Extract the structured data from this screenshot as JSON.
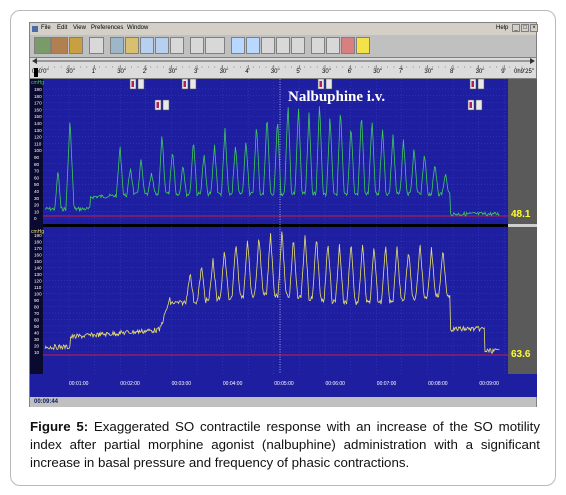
{
  "menu": [
    "File",
    "Edit",
    "View",
    "Preferences",
    "Window"
  ],
  "help_label": "Help",
  "window_controls": [
    "_",
    "□",
    "×"
  ],
  "ruler": {
    "start_label": "0h0'0\"",
    "end_label": "0h9'25\"",
    "labels": [
      "30\"",
      "1'",
      "30\"",
      "2'",
      "30\"",
      "3'",
      "30\"",
      "4'",
      "30\"",
      "5'",
      "30\"",
      "6'",
      "30\"",
      "7'",
      "30\"",
      "8'",
      "30\"",
      "9'"
    ]
  },
  "annotation_text": "Nalbuphine i.v.",
  "top_channel": {
    "unit": "cmHg",
    "ticks": [
      "190",
      "180",
      "170",
      "160",
      "150",
      "140",
      "130",
      "120",
      "110",
      "100",
      "90",
      "80",
      "70",
      "60",
      "50",
      "40",
      "30",
      "20",
      "10",
      "0"
    ],
    "value_readout": "48.1"
  },
  "bottom_channel": {
    "unit": "cmHg",
    "ticks": [
      "190",
      "180",
      "170",
      "160",
      "150",
      "140",
      "130",
      "120",
      "110",
      "100",
      "90",
      "80",
      "70",
      "60",
      "50",
      "40",
      "30",
      "20",
      "10"
    ],
    "value_readout": "63.6"
  },
  "time_labels": [
    "00:01:00",
    "00:02:00",
    "00:03:00",
    "00:04:00",
    "00:05:00",
    "00:06:00",
    "00:07:00",
    "00:08:00",
    "00:09:00"
  ],
  "status_time": "00:09:44",
  "caption": {
    "label": "Figure 5:",
    "text": " Exaggerated SO contractile response with an increase of the SO motility index after partial morphine agonist (nalbuphine) administration with a significant increase in basal pressure and frequency of phasic contractions."
  },
  "colors": {
    "plot_background": "#1e1ea0",
    "top_trace": "#3ecb5a",
    "bottom_trace": "#e8e070",
    "baseline": "#cc2040",
    "readout": "#ffff30"
  }
}
